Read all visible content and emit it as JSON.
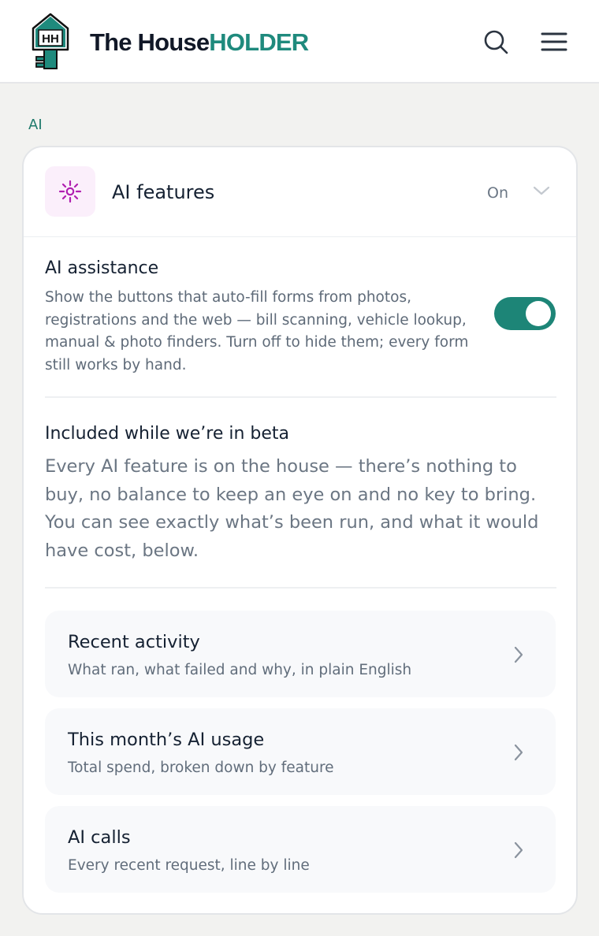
{
  "header": {
    "brand_part1": "The House",
    "brand_part2": "HOLDER",
    "logo_letters": "HH",
    "brand_color": "#1f8a7d",
    "search_icon": "search-icon",
    "menu_icon": "hamburger-menu-icon"
  },
  "section": {
    "label": "AI"
  },
  "ai_features": {
    "icon": "sparkle-icon",
    "title": "AI features",
    "status": "On",
    "expanded": true,
    "accent_color": "#b01fb0"
  },
  "assistance": {
    "title": "AI assistance",
    "description": "Show the buttons that auto-fill forms from photos, registrations and the web — bill scanning, vehicle lookup, manual & photo finders. Turn off to hide them; every form still works by hand.",
    "enabled": true,
    "toggle_color": "#1d8577"
  },
  "beta": {
    "title": "Included while we’re in beta",
    "body": "Every AI feature is on the house — there’s nothing to buy, no balance to keep an eye on and no key to bring. You can see exactly what’s been run, and what it would have cost, below."
  },
  "nav": [
    {
      "title": "Recent activity",
      "subtitle": "What ran, what failed and why, in plain English"
    },
    {
      "title": "This month’s AI usage",
      "subtitle": "Total spend, broken down by feature"
    },
    {
      "title": "AI calls",
      "subtitle": "Every recent request, line by line"
    }
  ]
}
